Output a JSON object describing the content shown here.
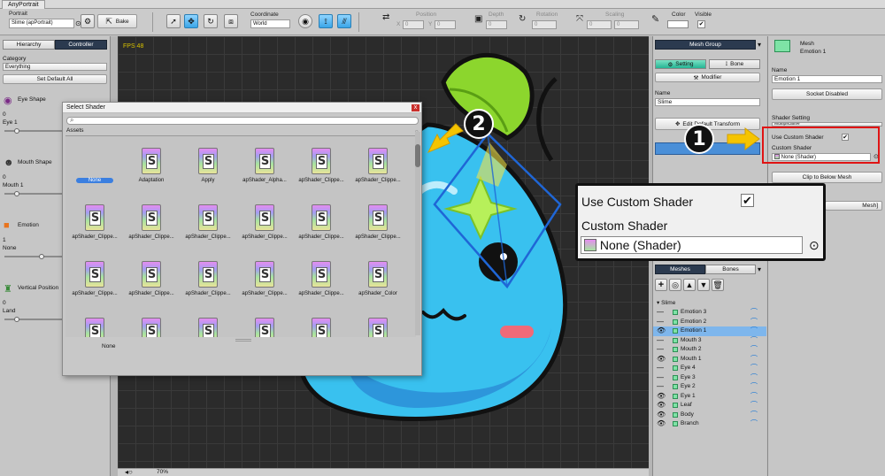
{
  "window": {
    "tab_title": "AnyPortrait"
  },
  "toolbar": {
    "portrait_label": "Portrait",
    "portrait_value": "Slime (apPortrait)",
    "bake_label": "Bake",
    "coordinate_label": "Coordinate",
    "coordinate_value": "World",
    "position_label": "Position",
    "x_label": "X",
    "x_value": "0",
    "y_label": "Y",
    "y_value": "0",
    "depth_label": "Depth",
    "depth_value": "0",
    "rotation_label": "Rotation",
    "rotation_value": "0",
    "scaling_label": "Scaling",
    "scale_x": "0",
    "scale_y": "0",
    "color_label": "Color",
    "visible_label": "Visible"
  },
  "left_panel": {
    "tabs": [
      "Hierarchy",
      "Controller"
    ],
    "category_label": "Category",
    "category_value": "Everything",
    "set_default_button": "Set Default All",
    "controllers": [
      {
        "name": "Eye Shape",
        "icon": "eye-icon",
        "value": "0",
        "sub": "Eye 1",
        "fraction": 0.1
      },
      {
        "name": "Mouth Shape",
        "icon": "mouth-icon",
        "value": "0",
        "sub": "Mouth 1",
        "fraction": 0.1
      },
      {
        "name": "Emotion",
        "icon": "cube-icon",
        "value": "1",
        "sub": "None",
        "fraction": 0.35
      },
      {
        "name": "Vertical Position",
        "icon": "figure-icon",
        "value": "0",
        "sub": "Land",
        "fraction": 0.1
      }
    ]
  },
  "canvas": {
    "fps": "FPS 48",
    "zoom": "70%"
  },
  "dialog": {
    "title": "Select Shader",
    "close": "x",
    "assets_tab": "Assets",
    "items": [
      "None",
      "Adaptation",
      "Apply",
      "apShader_Alpha...",
      "apShader_Clippe...",
      "apShader_Clippe...",
      "apShader_Clippe...",
      "apShader_Clippe...",
      "apShader_Clippe...",
      "apShader_Clippe...",
      "apShader_Clippe...",
      "apShader_Clippe...",
      "apShader_Clippe...",
      "apShader_Clippe...",
      "apShader_Clippe...",
      "apShader_Clippe...",
      "apShader_Clippe...",
      "apShader_Color",
      "",
      "",
      "",
      "",
      "",
      ""
    ],
    "selected_index": 0,
    "status": "None"
  },
  "mesh_group_panel": {
    "title": "Mesh Group",
    "setting_tab": "Setting",
    "bone_tab": "Bone",
    "modifier_button": "Modifier",
    "name_label": "Name",
    "name_value": "Slime",
    "edit_button": "Edit Default Transform",
    "meshes_tab": "Meshes",
    "bones_tab": "Bones",
    "tree_root": "Slime",
    "tree_items": [
      {
        "name": "Emotion 3",
        "visible": false,
        "selected": false
      },
      {
        "name": "Emotion 2",
        "visible": false,
        "selected": false
      },
      {
        "name": "Emotion 1",
        "visible": true,
        "selected": true
      },
      {
        "name": "Mouth 3",
        "visible": false,
        "selected": false
      },
      {
        "name": "Mouth 2",
        "visible": false,
        "selected": false
      },
      {
        "name": "Mouth 1",
        "visible": true,
        "selected": false
      },
      {
        "name": "Eye 4",
        "visible": false,
        "selected": false
      },
      {
        "name": "Eye 3",
        "visible": false,
        "selected": false
      },
      {
        "name": "Eye 2",
        "visible": false,
        "selected": false
      },
      {
        "name": "Eye 1",
        "visible": true,
        "selected": false
      },
      {
        "name": "Leaf",
        "visible": true,
        "selected": false
      },
      {
        "name": "Body",
        "visible": true,
        "selected": false
      },
      {
        "name": "Branch",
        "visible": true,
        "selected": false
      }
    ]
  },
  "props_panel": {
    "type_label": "Mesh",
    "type_name": "Emotion 1",
    "name_label": "Name",
    "name_value": "Emotion 1",
    "socket_button": "Socket Disabled",
    "shader_setting_label": "Shader Setting",
    "shader_blend_value": "Multiplicative",
    "use_custom_shader_label": "Use Custom Shader",
    "use_custom_shader_checked": true,
    "custom_shader_label": "Custom Shader",
    "custom_shader_value": "None (Shader)",
    "clip_button": "Clip to Below Mesh",
    "mesh_fragment": "Mesh]"
  },
  "callout": {
    "use_custom_shader_label": "Use Custom Shader",
    "custom_shader_label": "Custom Shader",
    "custom_shader_value": "None (Shader)"
  },
  "badges": [
    "1",
    "2"
  ],
  "colors": {
    "highlight_red": "#e01414",
    "arrow_yellow": "#f5c400",
    "selection_blue": "#3b7fe0",
    "active_tab": "#2b3a4f"
  }
}
